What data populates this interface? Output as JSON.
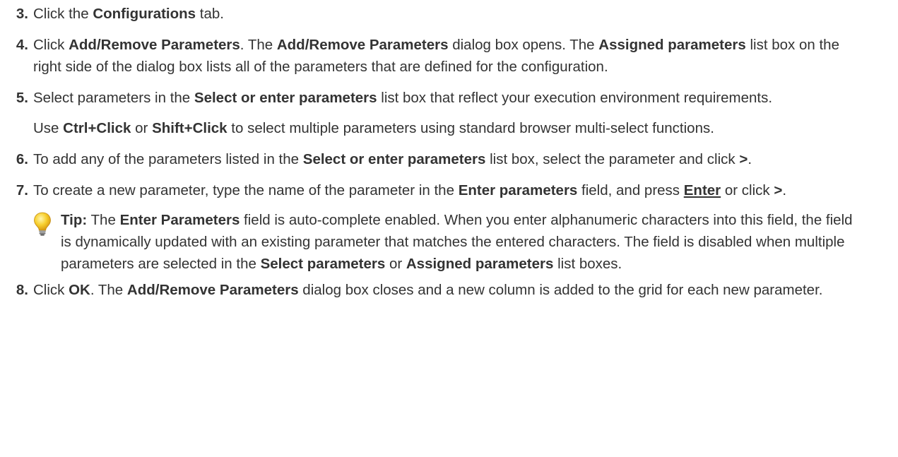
{
  "steps": [
    {
      "num": "3.",
      "p": [
        [
          "Click ",
          "the",
          " "
        ],
        []
      ]
    }
  ],
  "s3": {
    "num": "3.",
    "a": "Click the ",
    "b": "Configurations",
    "c": " tab."
  },
  "s4": {
    "num": "4.",
    "a": "Click ",
    "b": "Add/Remove Parameters",
    "c": ". The ",
    "d": "Add/Remove Parameters",
    "e": " dialog box opens. The ",
    "f": "Assigned parameters",
    "g": " list box on the right side of the dialog box lists all of the parameters that are defined for the configuration."
  },
  "s5": {
    "num": "5.",
    "a": "Select parameters in the ",
    "b": "Select or enter parameters",
    "c": " list box that reflect your execution environment requirements.",
    "d": "Use ",
    "e": "Ctrl+Click",
    "f": " or ",
    "g": "Shift+Click",
    "h": " to select multiple parameters using standard browser multi-select functions."
  },
  "s6": {
    "num": "6.",
    "a": "To add any of the parameters listed in the ",
    "b": "Select or enter parameters",
    "c": " list box, select the parameter and click ",
    "d": ">",
    "e": "."
  },
  "s7": {
    "num": "7.",
    "a": "To create a new parameter, type the name of the parameter in the ",
    "b": "Enter parameters",
    "c": " field, and press ",
    "d": "Enter",
    "e": " or click ",
    "f": ">",
    "g": "."
  },
  "tip": {
    "icon": "lightbulb-icon",
    "a": "Tip:",
    "b": " The ",
    "c": "Enter Parameters",
    "d": " field is auto-complete enabled. When you enter alphanumeric characters into this field, the field is dynamically updated with an existing parameter that matches the entered characters. The field is disabled when multiple parameters are selected in the ",
    "e": "Select parameters",
    "f": " or ",
    "g": "Assigned parameters",
    "h": " list boxes."
  },
  "s8": {
    "num": "8.",
    "a": "Click ",
    "b": "OK",
    "c": ". The ",
    "d": "Add/Remove Parameters",
    "e": " dialog box closes and a new column is added to the grid for each new parameter."
  }
}
